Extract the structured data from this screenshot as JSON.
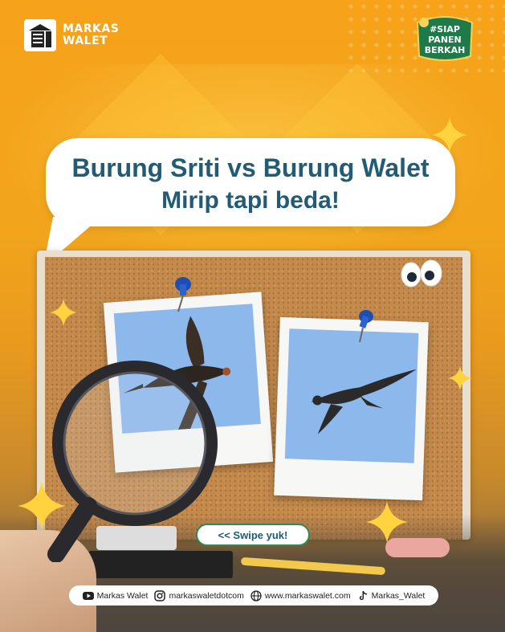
{
  "brand": {
    "name": "MARKAS\nWALET"
  },
  "campaign_badge": {
    "line1": "#SIAP",
    "line2": "PANEN",
    "line3": "BERKAH"
  },
  "headline": {
    "line1": "Burung Sriti vs Burung Walet",
    "line2": "Mirip tapi beda!"
  },
  "swipe_button": {
    "label": "<< Swipe yuk!"
  },
  "footer": {
    "youtube": "Markas Walet",
    "instagram": "markaswaletdotcom",
    "website": "www.markaswalet.com",
    "tiktok": "Markas_Walet"
  },
  "icons": [
    "youtube-icon",
    "instagram-icon",
    "globe-icon",
    "tiktok-icon",
    "push-pin-icon",
    "googly-eyes-icon",
    "sparkle-star-icon",
    "magnifying-glass-icon"
  ],
  "colors": {
    "background": "#f6a21a",
    "headline": "#225b74",
    "accent_green": "#2e8b57",
    "cork": "#c48a4c"
  }
}
